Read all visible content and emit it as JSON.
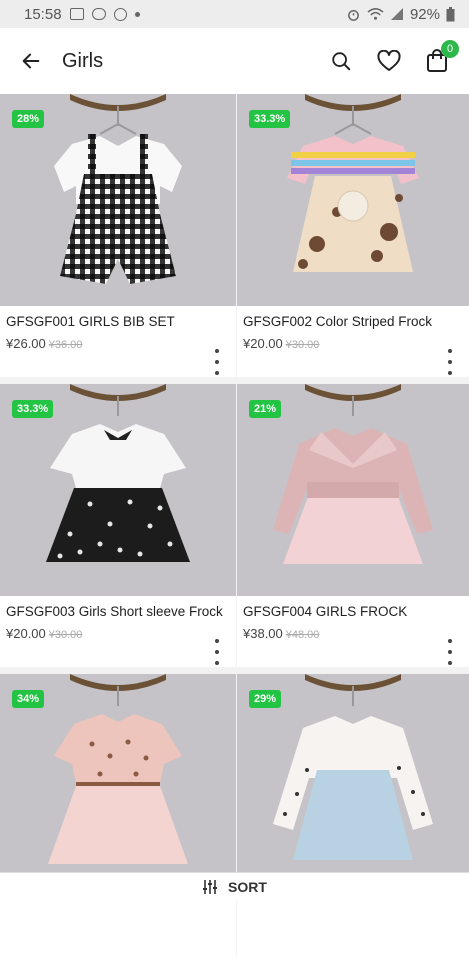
{
  "status_bar": {
    "time": "15:58",
    "battery": "92%"
  },
  "app_bar": {
    "title": "Girls",
    "cart_count": "0"
  },
  "products": [
    {
      "discount": "28%",
      "name": "GFSGF001 GIRLS BIB SET",
      "price": "¥26.00",
      "old_price": "¥36.00"
    },
    {
      "discount": "33.3%",
      "name": "GFSGF002 Color Striped Frock",
      "price": "¥20.00",
      "old_price": "¥30.00"
    },
    {
      "discount": "33.3%",
      "name": "GFSGF003 Girls Short sleeve Frock",
      "price": "¥20.00",
      "old_price": "¥30.00"
    },
    {
      "discount": "21%",
      "name": "GFSGF004 GIRLS FROCK",
      "price": "¥38.00",
      "old_price": "¥48.00"
    },
    {
      "discount": "34%",
      "name": "",
      "price": "",
      "old_price": ""
    },
    {
      "discount": "29%",
      "name": "",
      "price": "",
      "old_price": ""
    }
  ],
  "sort_bar": {
    "label": "SORT"
  },
  "colors": {
    "accent": "#23c343",
    "photo_bg": "#c4c2c6"
  }
}
